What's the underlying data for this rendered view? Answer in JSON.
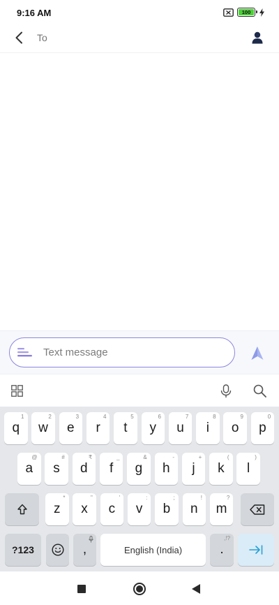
{
  "status_bar": {
    "time": "9:16 AM",
    "battery_level": "100",
    "icons": [
      "no-sim-icon",
      "battery-icon",
      "charging-bolt-icon"
    ]
  },
  "header": {
    "to_placeholder": "To",
    "icons": [
      "back-arrow-icon",
      "contact-person-icon"
    ]
  },
  "compose": {
    "placeholder": "Text message",
    "accent_color": "#8b86e0",
    "icons": [
      "attach-icon",
      "send-icon"
    ]
  },
  "keyboard_toolbar": {
    "icons": [
      "grid-icon",
      "mic-icon",
      "search-icon"
    ]
  },
  "keyboard": {
    "row1": [
      {
        "label": "q",
        "hint": "1"
      },
      {
        "label": "w",
        "hint": "2"
      },
      {
        "label": "e",
        "hint": "3"
      },
      {
        "label": "r",
        "hint": "4"
      },
      {
        "label": "t",
        "hint": "5"
      },
      {
        "label": "y",
        "hint": "6"
      },
      {
        "label": "u",
        "hint": "7"
      },
      {
        "label": "i",
        "hint": "8"
      },
      {
        "label": "o",
        "hint": "9"
      },
      {
        "label": "p",
        "hint": "0"
      }
    ],
    "row2": [
      {
        "label": "a",
        "hint": "@"
      },
      {
        "label": "s",
        "hint": "#"
      },
      {
        "label": "d",
        "hint": "₹"
      },
      {
        "label": "f",
        "hint": "_"
      },
      {
        "label": "g",
        "hint": "&"
      },
      {
        "label": "h",
        "hint": "-"
      },
      {
        "label": "j",
        "hint": "+"
      },
      {
        "label": "k",
        "hint": "("
      },
      {
        "label": "l",
        "hint": ")"
      }
    ],
    "row3": [
      {
        "label": "z",
        "hint": "*"
      },
      {
        "label": "x",
        "hint": "\""
      },
      {
        "label": "c",
        "hint": "'"
      },
      {
        "label": "v",
        "hint": ":"
      },
      {
        "label": "b",
        "hint": ";"
      },
      {
        "label": "n",
        "hint": "!"
      },
      {
        "label": "m",
        "hint": "?"
      }
    ],
    "symbols_label": "?123",
    "comma_label": ",",
    "space_label": "English (India)",
    "period_label": ".",
    "period_hint": ",!?",
    "icons": [
      "shift-icon",
      "backspace-icon",
      "emoji-icon",
      "enter-tab-icon"
    ]
  },
  "nav_bar": {
    "icons": [
      "recents-square-icon",
      "home-circle-icon",
      "back-triangle-icon"
    ]
  }
}
